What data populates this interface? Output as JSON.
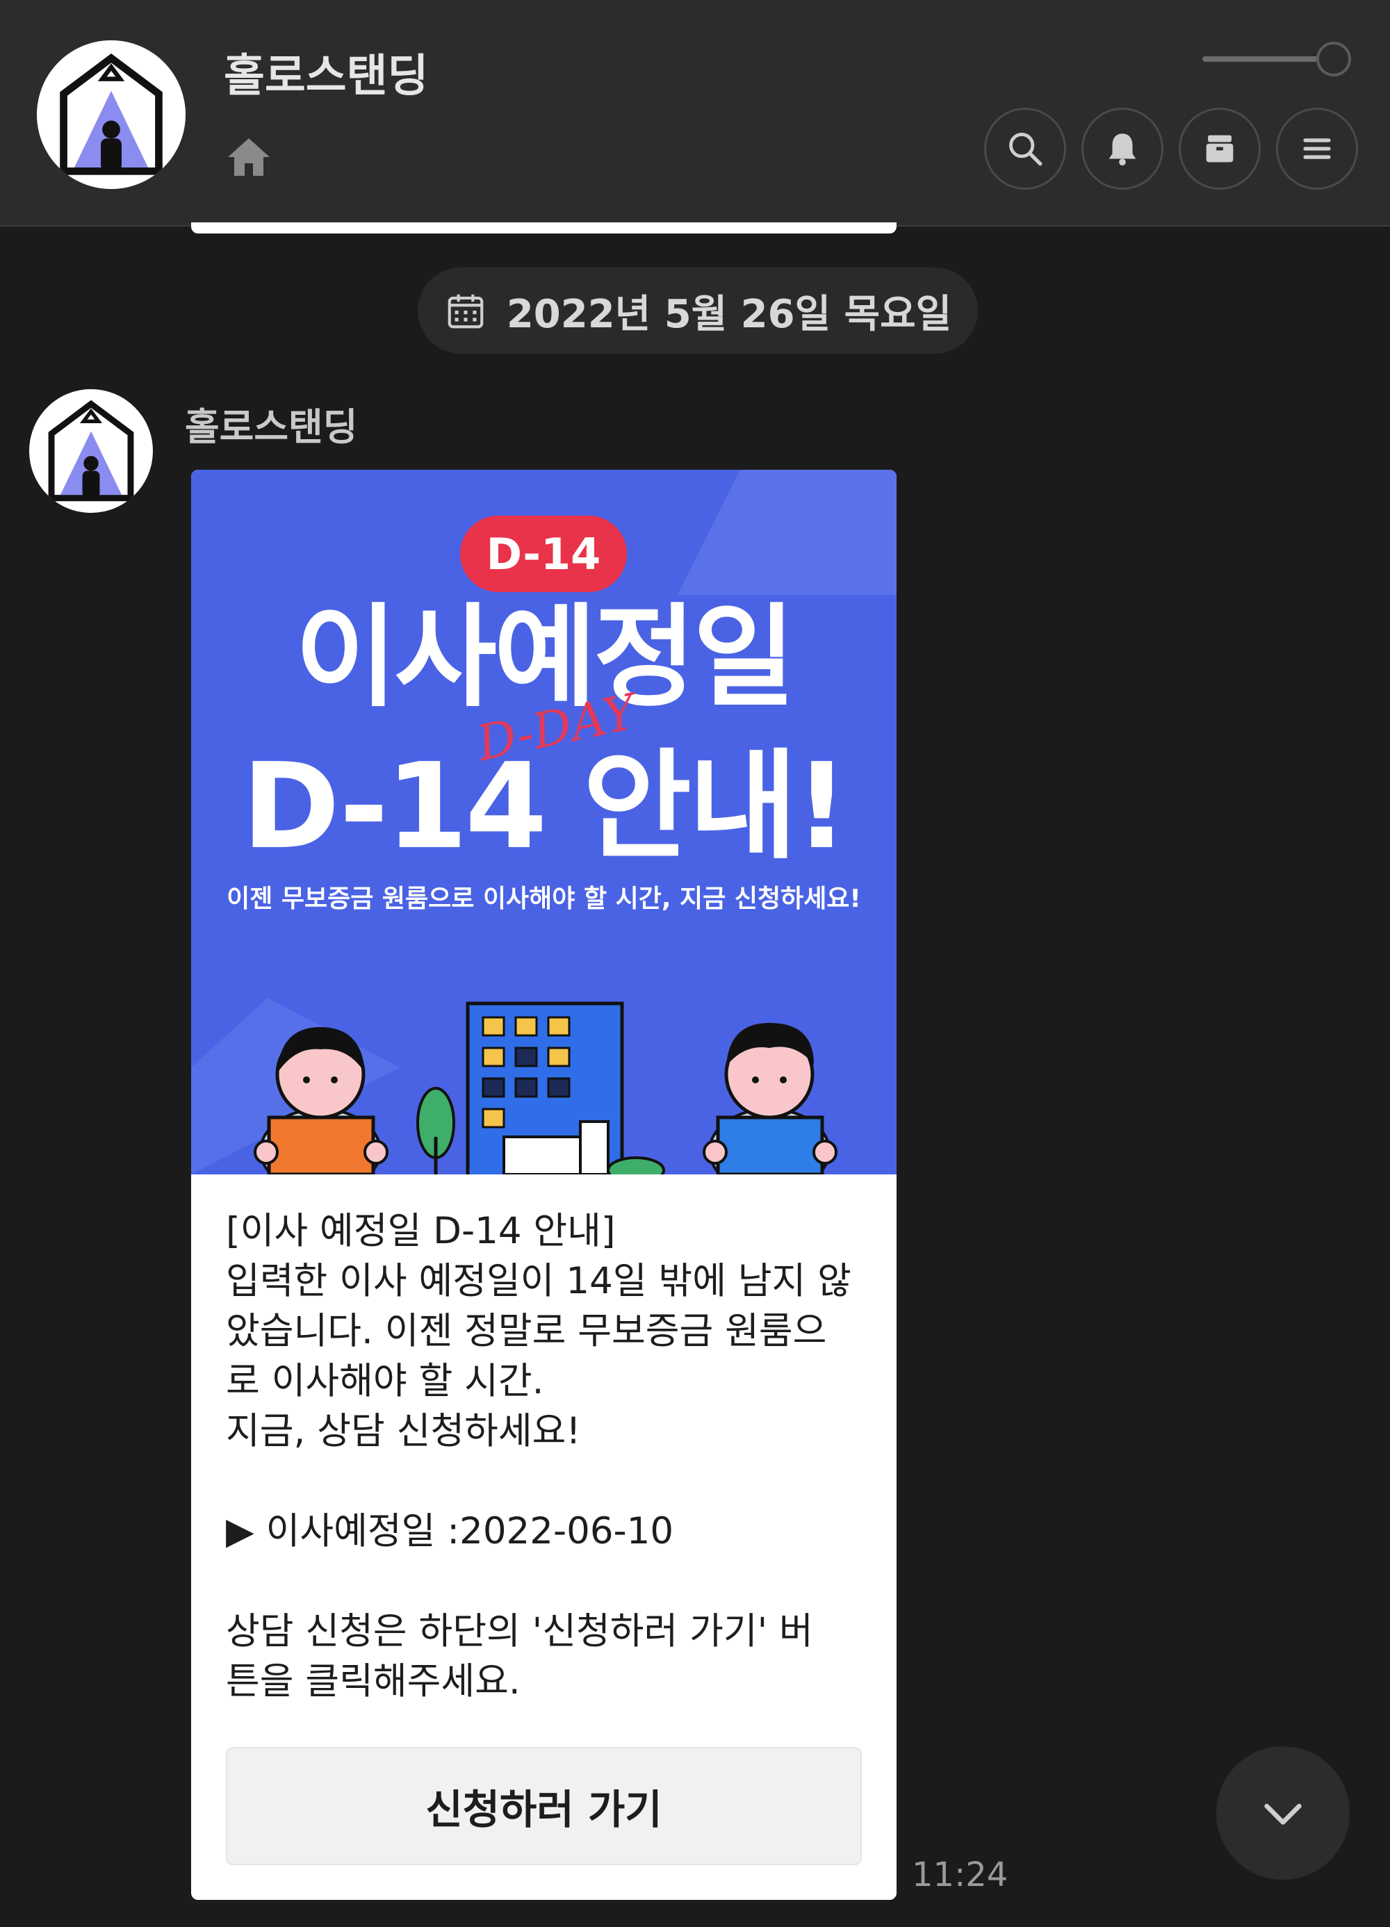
{
  "header": {
    "title": "홀로스탠딩",
    "icons": [
      "home-icon",
      "search-icon",
      "bell-icon",
      "archive-icon",
      "menu-icon"
    ]
  },
  "date_divider": {
    "text": "2022년 5월 26일 목요일",
    "icon": "calendar-icon"
  },
  "message": {
    "sender": "홀로스탠딩",
    "banner": {
      "badge": "D-14",
      "title_line1": "이사예정일",
      "script": "D-DAY",
      "title_line2": "D-14 안내!",
      "subtitle": "이젠 무보증금 원룸으로 이사해야 할 시간, 지금 신청하세요!"
    },
    "lines": [
      "[이사 예정일 D-14 안내]",
      "입력한 이사 예정일이 14일 밖에 남지 않",
      "았습니다. 이젠 정말로 무보증금 원룸으",
      "로 이사해야 할 시간.",
      "지금, 상담 신청하세요!",
      "",
      "▶ 이사예정일 :2022-06-10",
      "",
      "상담 신청은 하단의 '신청하러 가기' 버",
      "튼을 클릭해주세요."
    ],
    "cta_label": "신청하러 가기",
    "time": "11:24"
  },
  "colors": {
    "background": "#1b1b1b",
    "header": "#2c2c2c",
    "banner_blue": "#4a63e4",
    "badge_red": "#e8334a"
  }
}
